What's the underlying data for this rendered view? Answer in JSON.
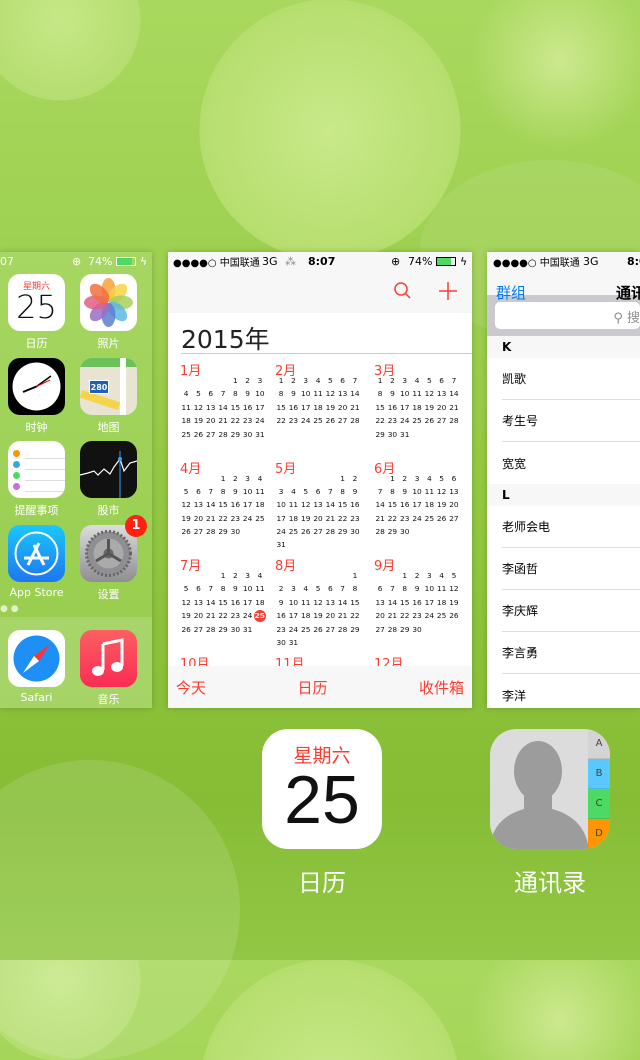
{
  "status": {
    "carrier": "●●●●○ 中国联通",
    "network": "3G",
    "time": "8:07",
    "time_partial": "07",
    "battery": "74%",
    "time_cut": "8:0"
  },
  "home": {
    "apps": [
      {
        "label": "日历",
        "icon": "calendar-icon",
        "weekday": "星期六",
        "day": "25"
      },
      {
        "label": "照片",
        "icon": "photos-icon"
      },
      {
        "label": "时钟",
        "icon": "clock-icon"
      },
      {
        "label": "地图",
        "icon": "maps-icon",
        "shield": "280"
      },
      {
        "label": "提醒事项",
        "icon": "reminders-icon"
      },
      {
        "label": "股市",
        "icon": "stocks-icon"
      },
      {
        "label": "App Store",
        "icon": "app-store-icon"
      },
      {
        "label": "设置",
        "icon": "settings-icon",
        "badge": "1"
      }
    ],
    "dock": [
      {
        "label": "Safari",
        "icon": "safari-icon"
      },
      {
        "label": "音乐",
        "icon": "music-icon"
      }
    ]
  },
  "calendar": {
    "year_title": "2015年",
    "today": {
      "month": 7,
      "day": 25
    },
    "months": [
      {
        "label": "1月",
        "start": 4,
        "days": 31
      },
      {
        "label": "2月",
        "start": 0,
        "days": 28
      },
      {
        "label": "3月",
        "start": 0,
        "days": 31
      },
      {
        "label": "4月",
        "start": 3,
        "days": 30
      },
      {
        "label": "5月",
        "start": 5,
        "days": 31
      },
      {
        "label": "6月",
        "start": 1,
        "days": 30
      },
      {
        "label": "7月",
        "start": 3,
        "days": 31
      },
      {
        "label": "8月",
        "start": 6,
        "days": 31
      },
      {
        "label": "9月",
        "start": 2,
        "days": 30
      },
      {
        "label": "10月"
      },
      {
        "label": "11月"
      },
      {
        "label": "12月"
      }
    ],
    "tabs": {
      "today": "今天",
      "calendars": "日历",
      "inbox": "收件箱"
    },
    "accent": "#ff3b30"
  },
  "contacts": {
    "groups": "群组",
    "title": "通讯录",
    "search_placeholder": "搜",
    "sections": [
      {
        "letter": "K",
        "names": [
          "凯歌",
          "考生号",
          "宽宽"
        ]
      },
      {
        "letter": "L",
        "names": [
          "老师会电",
          "李函哲",
          "李庆辉",
          "李言勇",
          "李洋"
        ]
      }
    ],
    "accent": "#007aff"
  },
  "switcher": [
    {
      "label": "日历",
      "weekday": "星期六",
      "day": "25"
    },
    {
      "label": "通讯录",
      "tabs": [
        "A",
        "B",
        "C",
        "D"
      ]
    }
  ]
}
